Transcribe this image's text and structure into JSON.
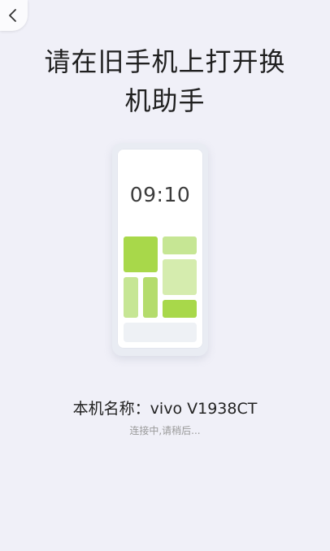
{
  "header": {
    "back_icon": "chevron-left-icon"
  },
  "title": {
    "line1": "请在旧手机上打开换",
    "line2": "机助手"
  },
  "illustration": {
    "clock_time": "09:10",
    "colors": {
      "tile_bright": "#A8D84A",
      "tile_mid": "#B4DC6C",
      "tile_light": "#C6E694",
      "tile_pale": "#D5ECAE"
    }
  },
  "device": {
    "name_line": "本机名称：vivo V1938CT"
  },
  "status": {
    "text": "连接中,请稍后..."
  },
  "colors": {
    "background": "#F0F0F8",
    "title_text": "#1F1F1F",
    "status_text": "#9A9A9A"
  }
}
